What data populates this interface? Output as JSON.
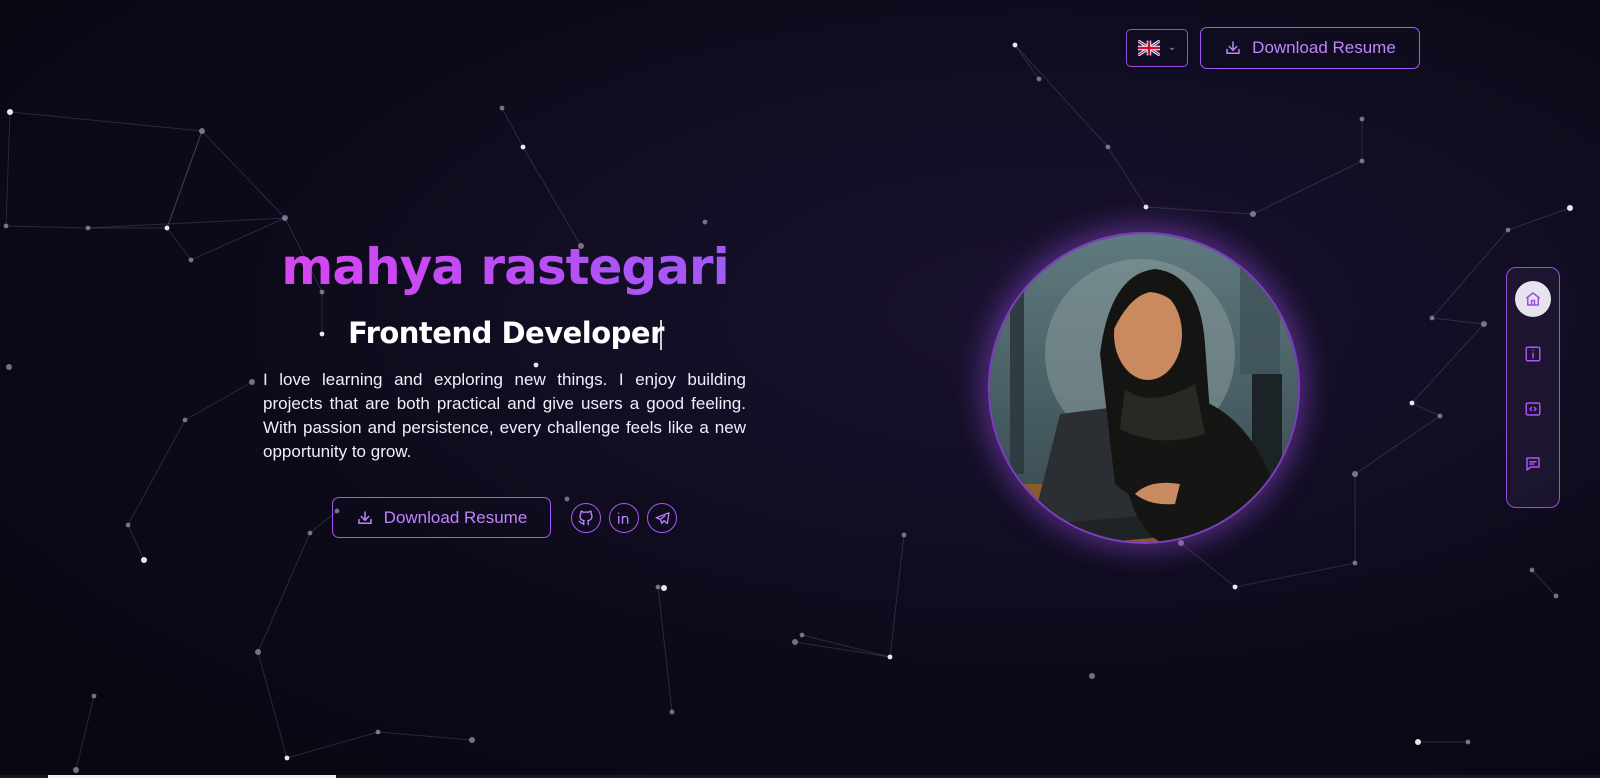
{
  "header": {
    "language": {
      "selected": "English (UK)",
      "icon": "uk-flag-icon"
    },
    "download_label": "Download Resume"
  },
  "hero": {
    "name": "mahya rastegari",
    "role": "Frontend Developer",
    "bio": "I love learning and exploring new things. I enjoy building projects that are both practical and give users a good feeling. With passion and persistence, every challenge feels like a new opportunity to grow.",
    "download_label": "Download Resume",
    "socials": [
      {
        "name": "GitHub",
        "icon": "github-icon"
      },
      {
        "name": "LinkedIn",
        "icon": "linkedin-icon"
      },
      {
        "name": "Telegram",
        "icon": "telegram-icon"
      }
    ]
  },
  "side_nav": [
    {
      "name": "Home",
      "icon": "home-icon",
      "active": true
    },
    {
      "name": "About",
      "icon": "info-icon",
      "active": false
    },
    {
      "name": "Projects",
      "icon": "code-icon",
      "active": false
    },
    {
      "name": "Contact",
      "icon": "message-icon",
      "active": false
    }
  ],
  "scroll_progress": 0.18,
  "colors": {
    "accent": "#a855f7",
    "accent_text": "#c084fc",
    "name_gradient_start": "#d946ef",
    "name_gradient_end": "#9b5cf6",
    "background": "#0c0a1a"
  }
}
